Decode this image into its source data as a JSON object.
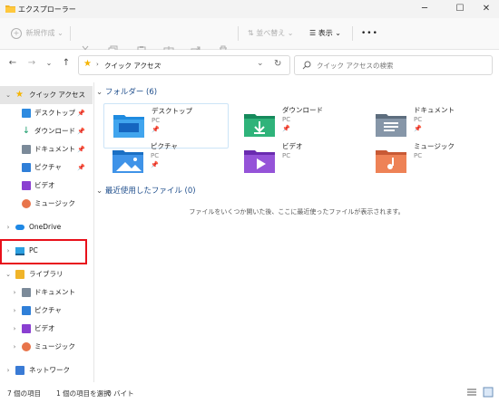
{
  "window": {
    "title": "エクスプローラー",
    "minimize": "─",
    "maximize": "☐",
    "close": "✕"
  },
  "toolbar": {
    "new_label": "新規作成",
    "sort_label": "並べ替え",
    "view_label": "表示",
    "more_label": "•••"
  },
  "address": {
    "breadcrumb": "クイック アクセス",
    "search_placeholder": "クイック アクセスの検索"
  },
  "sidebar": {
    "quick_access": "クイック アクセス",
    "qa_items": [
      {
        "label": "デスクトップ",
        "pinned": true
      },
      {
        "label": "ダウンロード",
        "pinned": true
      },
      {
        "label": "ドキュメント",
        "pinned": true
      },
      {
        "label": "ピクチャ",
        "pinned": true
      },
      {
        "label": "ビデオ",
        "pinned": false
      },
      {
        "label": "ミュージック",
        "pinned": false
      }
    ],
    "onedrive": "OneDrive",
    "pc": "PC",
    "library": "ライブラリ",
    "library_items": [
      {
        "label": "ドキュメント"
      },
      {
        "label": "ピクチャ"
      },
      {
        "label": "ビデオ"
      },
      {
        "label": "ミュージック"
      }
    ],
    "network": "ネットワーク"
  },
  "main": {
    "folders_header": "フォルダー (6)",
    "folders": [
      {
        "name": "デスクトップ",
        "location": "PC",
        "pinned": true
      },
      {
        "name": "ダウンロード",
        "location": "PC",
        "pinned": true
      },
      {
        "name": "ドキュメント",
        "location": "PC",
        "pinned": true
      },
      {
        "name": "ピクチャ",
        "location": "PC",
        "pinned": true
      },
      {
        "name": "ビデオ",
        "location": "PC",
        "pinned": false
      },
      {
        "name": "ミュージック",
        "location": "PC",
        "pinned": false
      }
    ],
    "recent_header": "最近使用したファイル (0)",
    "recent_empty": "ファイルをいくつか開いた後、ここに最近使ったファイルが表示されます。"
  },
  "status": {
    "item_count": "7 個の項目",
    "selected": "1 個の項目を選択",
    "size": "0 バイト"
  },
  "colors": {
    "accent": "#1f4e8c",
    "highlight_frame": "#e8101a",
    "selection": "#e5e5e5"
  }
}
